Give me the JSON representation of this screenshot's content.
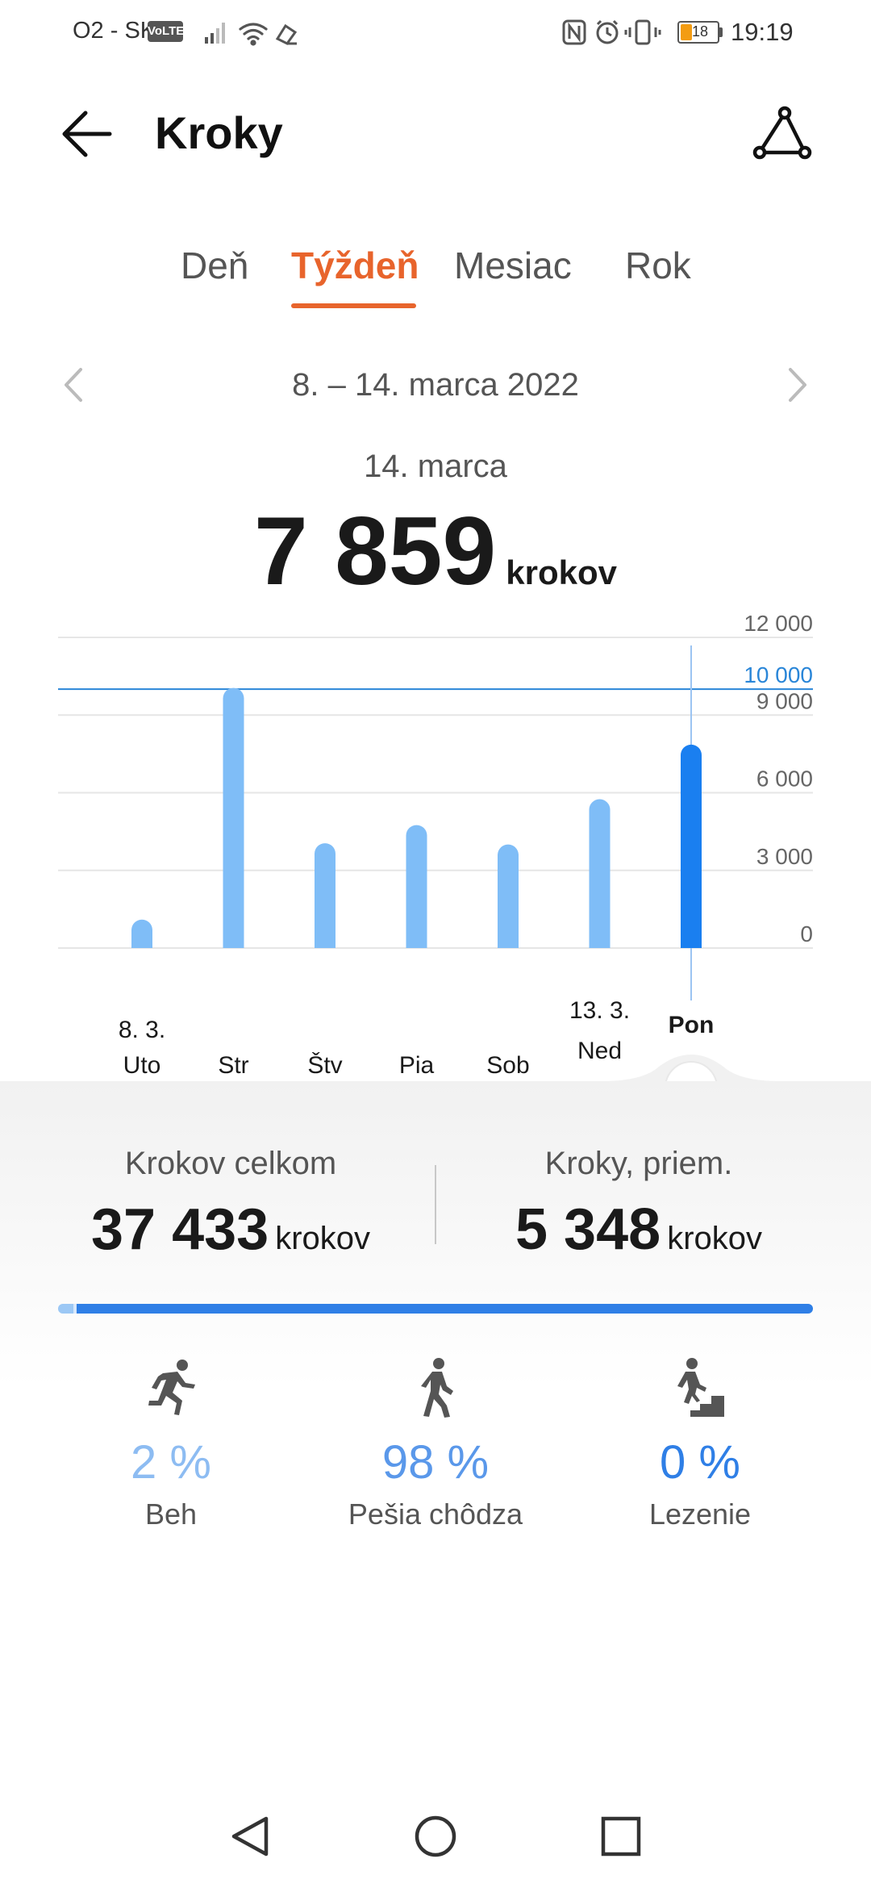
{
  "status_bar": {
    "carrier": "O2 - SK",
    "volte": "VoLTE",
    "battery": "18",
    "time": "19:19"
  },
  "header": {
    "title": "Kroky",
    "icons": {
      "back": "arrow-left-icon",
      "share": "share-icon"
    }
  },
  "tabs": [
    {
      "label": "Deň",
      "active": false
    },
    {
      "label": "Týždeň",
      "active": true
    },
    {
      "label": "Mesiac",
      "active": false
    },
    {
      "label": "Rok",
      "active": false
    }
  ],
  "date_range": "8. – 14. marca 2022",
  "selected": {
    "date": "14. marca",
    "value": "7 859",
    "unit": "krokov"
  },
  "chart_data": {
    "type": "bar",
    "categories": [
      "Uto",
      "Str",
      "Štv",
      "Pia",
      "Sob",
      "Ned",
      "Pon"
    ],
    "date_labels": [
      "8. 3.",
      "",
      "",
      "",
      "",
      "13. 3.",
      ""
    ],
    "values": [
      1100,
      10050,
      4050,
      4750,
      4000,
      5750,
      7859
    ],
    "ylim": [
      0,
      12000
    ],
    "yticks": [
      "0",
      "3 000",
      "6 000",
      "9 000",
      "12 000"
    ],
    "goal": 10000,
    "goal_label": "10 000",
    "selected_index": 6,
    "colors": {
      "bar": "#7fbdf7",
      "selected": "#1a7ff0",
      "goal": "#2a86d8"
    }
  },
  "summary": {
    "total_label": "Krokov celkom",
    "total_value": "37 433",
    "total_unit": "krokov",
    "avg_label": "Kroky, priem.",
    "avg_value": "5 348",
    "avg_unit": "krokov"
  },
  "activities": [
    {
      "pct": "2 %",
      "label": "Beh",
      "icon": "running-icon",
      "color": "#8dbcf2",
      "share": 0.02
    },
    {
      "pct": "98 %",
      "label": "Pešia chôdza",
      "icon": "walking-icon",
      "color": "#5a98ea",
      "share": 0.98
    },
    {
      "pct": "0 %",
      "label": "Lezenie",
      "icon": "climbing-icon",
      "color": "#2f7fe6",
      "share": 0.0
    }
  ],
  "nav_bar": {
    "back": "nav-back-icon",
    "home": "nav-home-icon",
    "recent": "nav-recent-icon"
  }
}
